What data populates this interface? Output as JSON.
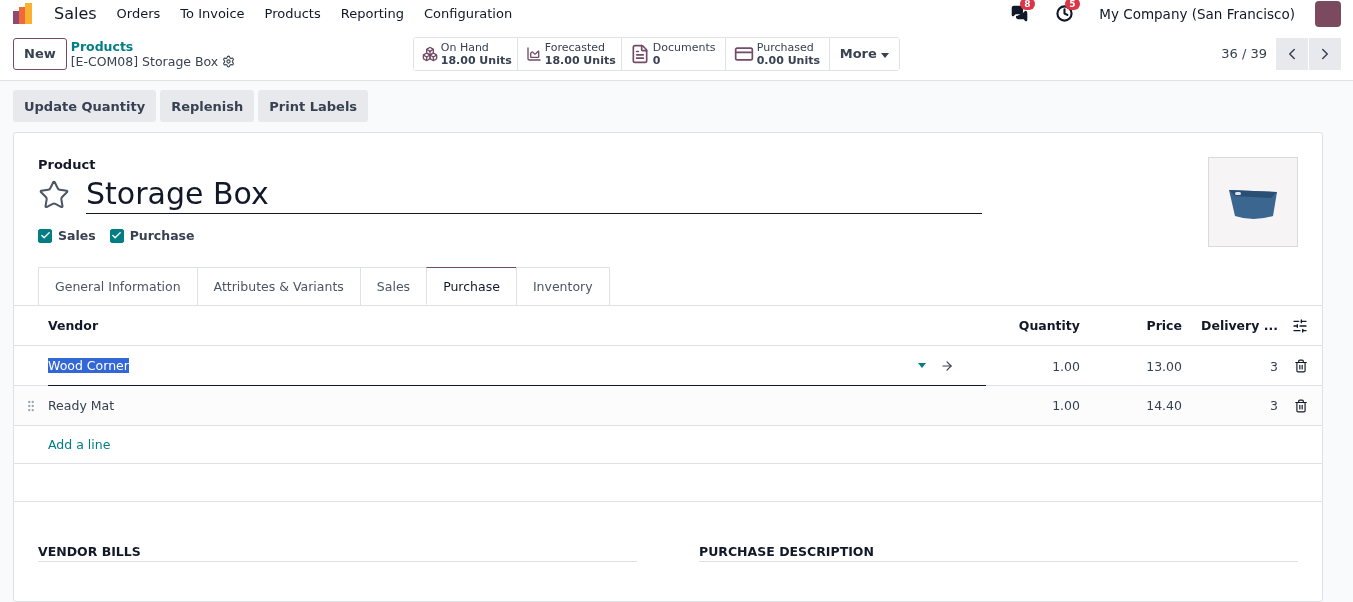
{
  "navbar": {
    "app": "Sales",
    "menu": [
      "Orders",
      "To Invoice",
      "Products",
      "Reporting",
      "Configuration"
    ],
    "messages_count": "8",
    "activities_count": "5",
    "company": "My Company (San Francisco)"
  },
  "control_panel": {
    "new_button": "New",
    "breadcrumb": "Products",
    "record": "[E-COM08] Storage Box",
    "stat_buttons": [
      {
        "kind": "onhand",
        "label": "On Hand",
        "value": "18.00 Units"
      },
      {
        "kind": "forecast",
        "label": "Forecasted",
        "value": "18.00 Units"
      },
      {
        "kind": "documents",
        "label": "Documents",
        "value": "0"
      },
      {
        "kind": "purchased",
        "label": "Purchased",
        "value": "0.00 Units"
      }
    ],
    "more": "More",
    "pager": "36 / 39"
  },
  "actions": [
    "Update Quantity",
    "Replenish",
    "Print Labels"
  ],
  "form": {
    "label": "Product",
    "name": "Storage Box",
    "favorite": false,
    "flags": [
      {
        "label": "Sales",
        "checked": true
      },
      {
        "label": "Purchase",
        "checked": true
      }
    ],
    "tabs": [
      {
        "label": "General Information",
        "selected": false
      },
      {
        "label": "Attributes & Variants",
        "selected": false
      },
      {
        "label": "Sales",
        "selected": false
      },
      {
        "label": "Purchase",
        "selected": true
      },
      {
        "label": "Inventory",
        "selected": false
      }
    ],
    "vendor_table": {
      "columns": [
        "Vendor",
        "Quantity",
        "Price",
        "Delivery ..."
      ],
      "rows": [
        {
          "vendor": "Wood Corner",
          "quantity": "1.00",
          "price": "13.00",
          "delivery": "3",
          "editing": true
        },
        {
          "vendor": "Ready Mat",
          "quantity": "1.00",
          "price": "14.40",
          "delivery": "3",
          "editing": false
        }
      ],
      "add_line": "Add a line"
    },
    "sections": [
      "VENDOR BILLS",
      "PURCHASE DESCRIPTION"
    ]
  }
}
